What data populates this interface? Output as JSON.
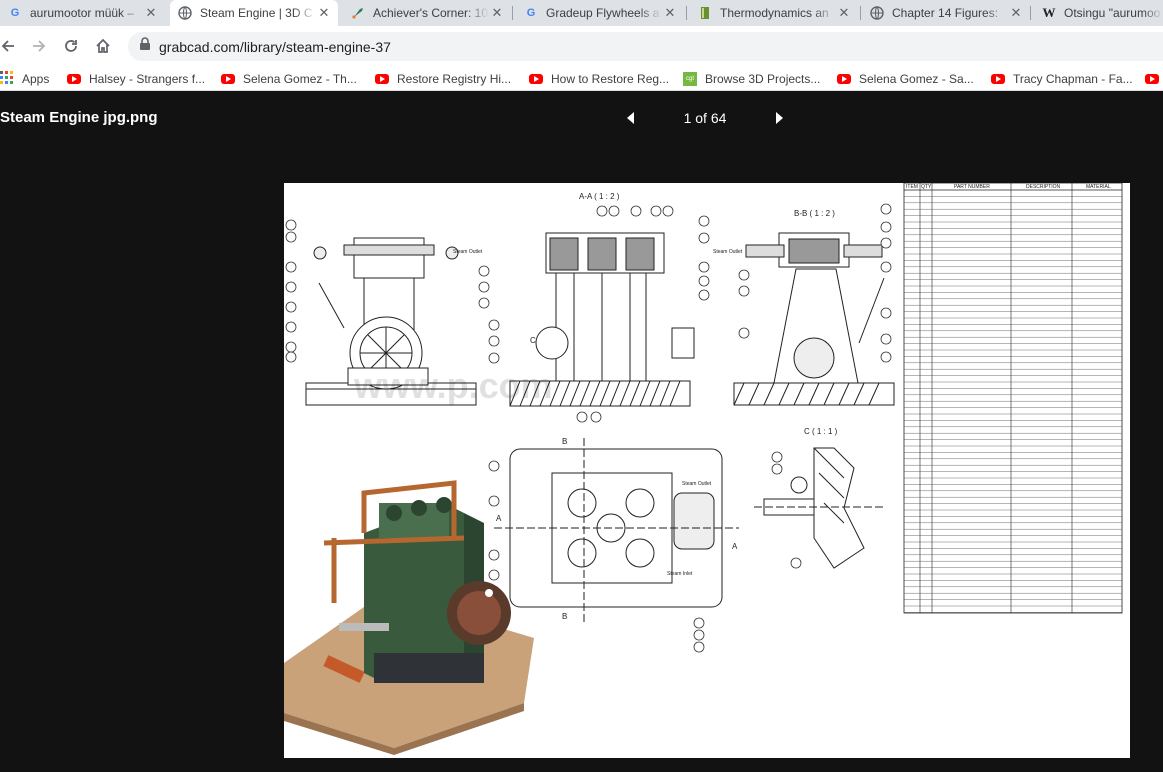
{
  "browser": {
    "tabs": [
      {
        "title": "aurumootor müük – ",
        "icon": "google-icon",
        "active": false
      },
      {
        "title": "Steam Engine | 3D C",
        "icon": "globe-icon",
        "active": true
      },
      {
        "title": "Achiever's Corner: 10",
        "icon": "rocket-icon",
        "active": false
      },
      {
        "title": "Gradeup Flywheels a",
        "icon": "google-icon",
        "active": false
      },
      {
        "title": "Thermodynamics an",
        "icon": "book-icon",
        "active": false
      },
      {
        "title": "Chapter 14 Figures: ",
        "icon": "globe-icon",
        "active": false
      },
      {
        "title": "Otsingu \"aurumoo",
        "icon": "wikipedia-icon",
        "active": false
      }
    ],
    "close_glyph": "✕",
    "url": "grabcad.com/library/steam-engine-37",
    "bookmarks": [
      {
        "label": "Apps",
        "icon": "apps-grid-icon"
      },
      {
        "label": "Halsey - Strangers f...",
        "icon": "youtube-icon"
      },
      {
        "label": "Selena Gomez - Th...",
        "icon": "youtube-icon"
      },
      {
        "label": "Restore Registry Hi...",
        "icon": "youtube-icon"
      },
      {
        "label": "How to Restore Reg...",
        "icon": "youtube-icon"
      },
      {
        "label": "Browse 3D Projects...",
        "icon": "cgt-icon"
      },
      {
        "label": "Selena Gomez - Sa...",
        "icon": "youtube-icon"
      },
      {
        "label": "Tracy Chapman - Fa...",
        "icon": "youtube-icon"
      }
    ]
  },
  "viewer": {
    "file_title": "Steam Engine jpg.png",
    "pager_text": "1 of 64"
  },
  "drawing": {
    "section_aa": "A-A ( 1 : 2 )",
    "section_bb": "B-B ( 1 : 2 )",
    "detail_c": "C ( 1 : 1 )",
    "label_b": "B",
    "label_a": "A",
    "label_c": "C",
    "steam_outlet": "Steam Outlet",
    "steam_inlet": "Steam Inlet",
    "bom_headers": [
      "ITEM",
      "QTY",
      "PART NUMBER",
      "DESCRIPTION",
      "MATERIAL"
    ],
    "watermark": "www.p.com",
    "colors": {
      "frame": "#3a5a3e",
      "copper": "#b5672f",
      "base": "#c9a27a"
    }
  }
}
